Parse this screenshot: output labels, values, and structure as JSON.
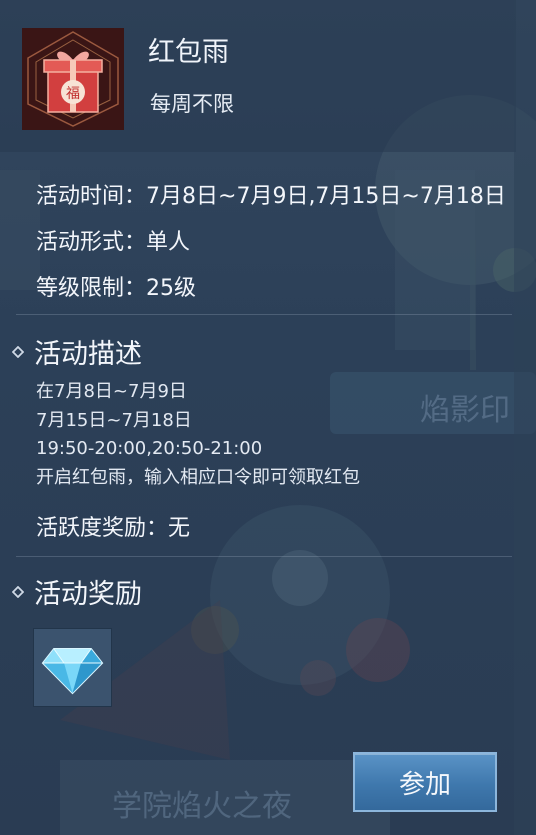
{
  "activity": {
    "title": "红包雨",
    "frequency": "每周不限",
    "icon": "red-gift-box-icon"
  },
  "info": {
    "time_label": "活动时间：",
    "time_value": "7月8日~7月9日,7月15日~7月18日",
    "form_label": "活动形式：",
    "form_value": "单人",
    "level_label": "等级限制：",
    "level_value": "25级"
  },
  "description": {
    "heading": "活动描述",
    "lines": [
      " 在7月8日~7月9日",
      "7月15日~7月18日",
      "19:50-20:00,20:50-21:00",
      "开启红包雨，输入相应口令即可领取红包"
    ],
    "activity_reward_label": "活跃度奖励：",
    "activity_reward_value": "无"
  },
  "rewards": {
    "heading": "活动奖励",
    "items": [
      {
        "icon": "blue-diamond-icon"
      }
    ]
  },
  "actions": {
    "join_label": "参加"
  },
  "background": {
    "banner1_text": "焰影印",
    "banner2_text": "学院焰火之夜"
  },
  "colors": {
    "panel_bg": "#2f435b",
    "text": "#f3f6fb",
    "button": "#4a84b9",
    "icon_red": "#c73a3a",
    "diamond": "#6fd3f5"
  }
}
